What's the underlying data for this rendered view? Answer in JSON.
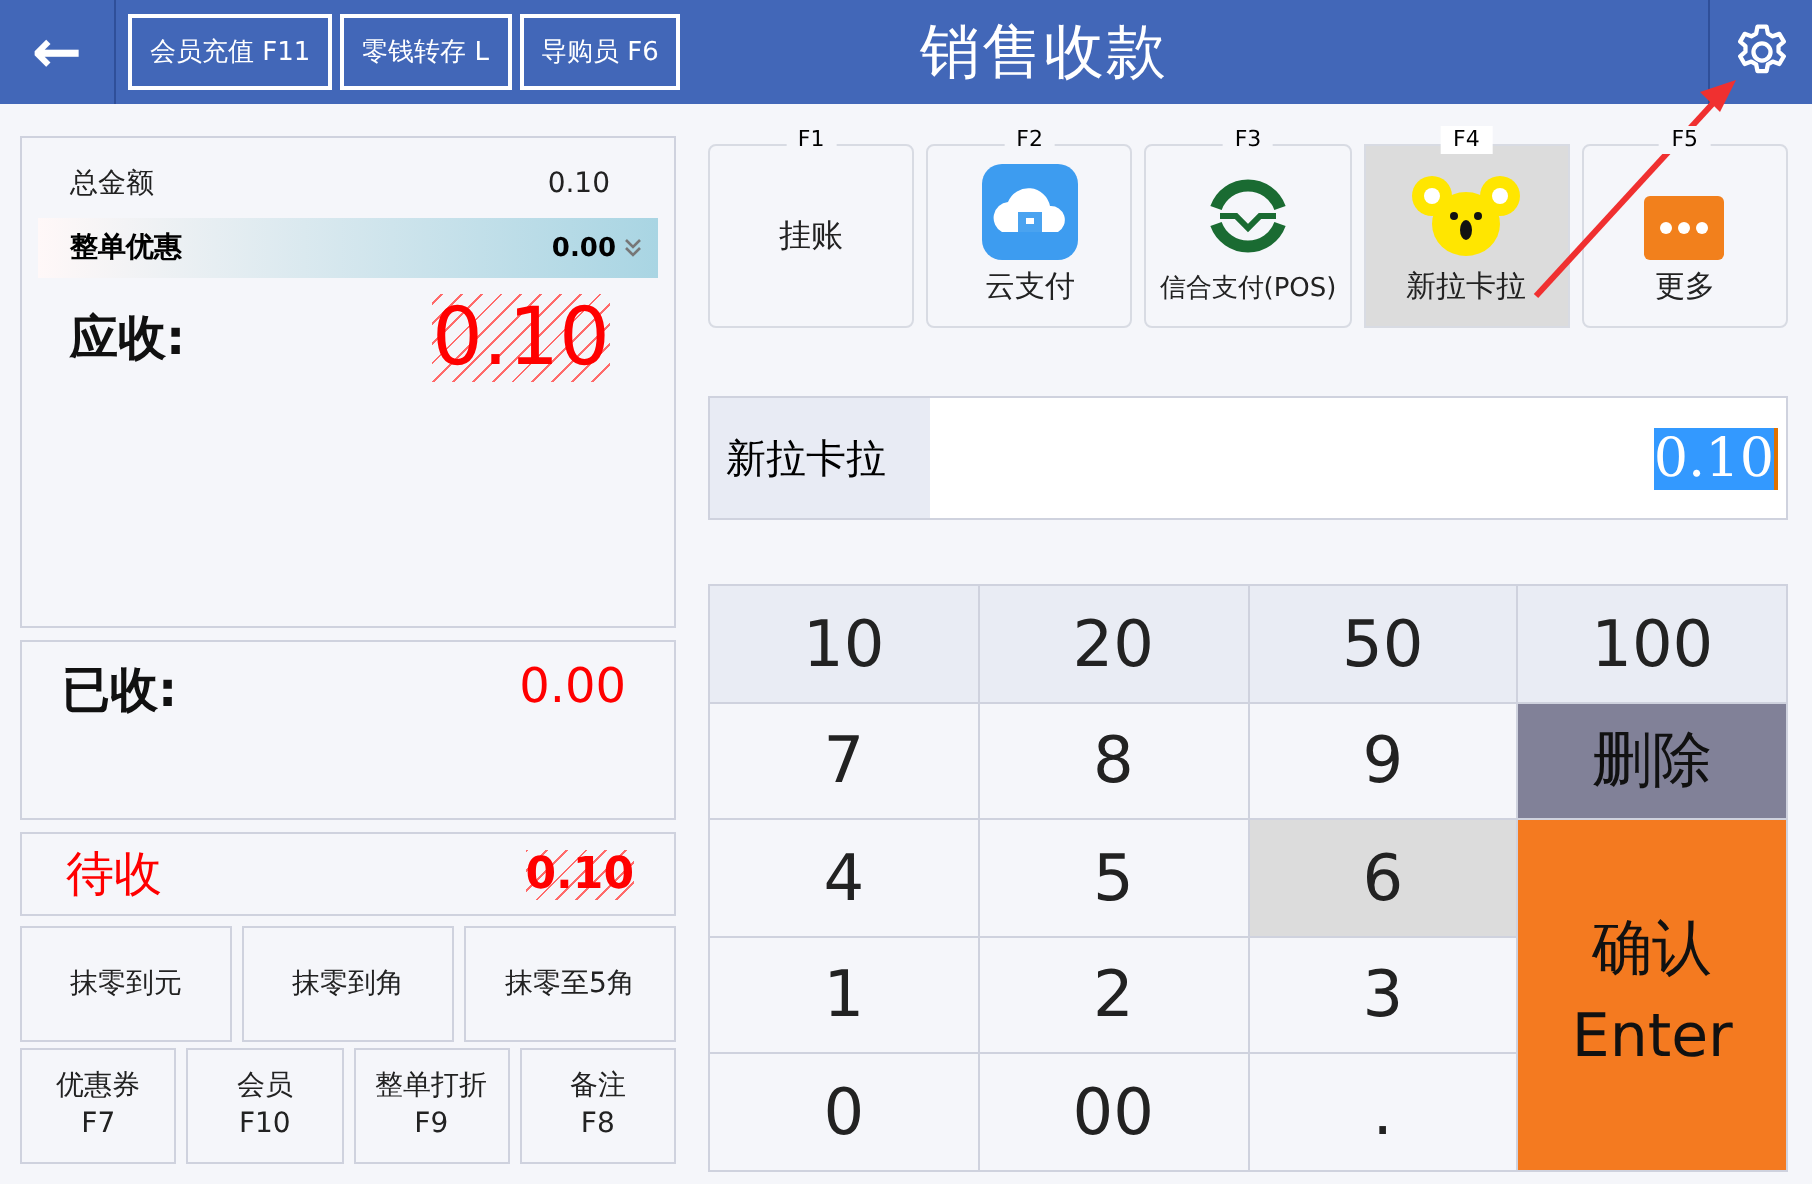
{
  "header": {
    "back": "←",
    "title": "销售收款",
    "buttons": [
      "会员充值 F11",
      "零钱转存 L",
      "导购员 F6"
    ]
  },
  "summary": {
    "total_label": "总金额",
    "total": "0.10",
    "discount_label": "整单优惠",
    "discount": "0.00",
    "due_label": "应收:",
    "due": "0.10"
  },
  "received": {
    "label": "已收:",
    "amount": "0.00"
  },
  "pending": {
    "label": "待收",
    "amount": "0.10"
  },
  "round_buttons": [
    "抹零到元",
    "抹零到角",
    "抹零至5角"
  ],
  "function_buttons": [
    {
      "label": "优惠券",
      "key": "F7"
    },
    {
      "label": "会员",
      "key": "F10"
    },
    {
      "label": "整单打折",
      "key": "F9"
    },
    {
      "label": "备注",
      "key": "F8"
    }
  ],
  "payment_methods": [
    {
      "key": "F1",
      "label": "挂账",
      "kind": "text",
      "selected": false
    },
    {
      "key": "F2",
      "label": "云支付",
      "kind": "cloud",
      "selected": false
    },
    {
      "key": "F3",
      "label": "信合支付(POS)",
      "kind": "pos",
      "selected": false
    },
    {
      "key": "F4",
      "label": "新拉卡拉",
      "kind": "koala",
      "selected": true
    },
    {
      "key": "F5",
      "label": "更多",
      "kind": "more",
      "selected": false
    }
  ],
  "amount_field": {
    "label": "新拉卡拉",
    "value": "0.10"
  },
  "keypad": [
    {
      "label": "10",
      "kind": "quick",
      "pressed": false
    },
    {
      "label": "20",
      "kind": "quick",
      "pressed": false
    },
    {
      "label": "50",
      "kind": "quick",
      "pressed": false
    },
    {
      "label": "100",
      "kind": "quick",
      "pressed": false
    },
    {
      "label": "7",
      "kind": "digit",
      "pressed": false
    },
    {
      "label": "8",
      "kind": "digit",
      "pressed": false
    },
    {
      "label": "9",
      "kind": "digit",
      "pressed": false
    },
    {
      "label": "删除",
      "kind": "delete",
      "pressed": false
    },
    {
      "label": "4",
      "kind": "digit",
      "pressed": false
    },
    {
      "label": "5",
      "kind": "digit",
      "pressed": false
    },
    {
      "label": "6",
      "kind": "digit",
      "pressed": true
    },
    {
      "label": "1",
      "kind": "digit",
      "pressed": false
    },
    {
      "label": "2",
      "kind": "digit",
      "pressed": false
    },
    {
      "label": "3",
      "kind": "digit",
      "pressed": false
    },
    {
      "label": "0",
      "kind": "digit",
      "pressed": false
    },
    {
      "label": "00",
      "kind": "digit",
      "pressed": false
    },
    {
      "label": ".",
      "kind": "digit",
      "pressed": false
    },
    {
      "label": "确认\nEnter",
      "kind": "confirm",
      "pressed": false
    }
  ]
}
